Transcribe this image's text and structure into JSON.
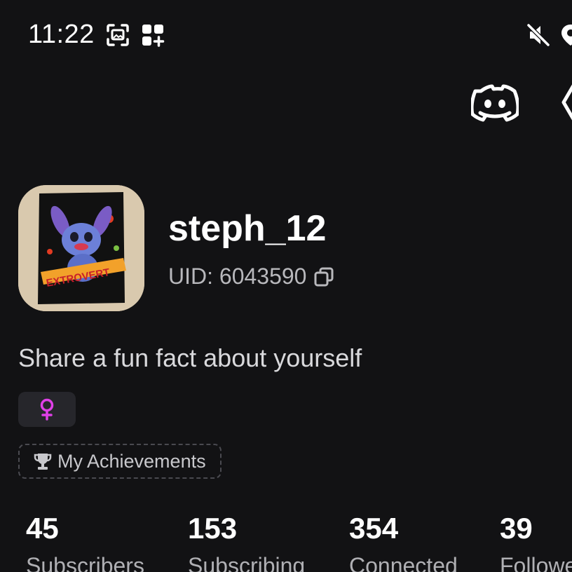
{
  "status_bar": {
    "time": "11:22",
    "icons": [
      "screenshot-icon",
      "apps-add-icon",
      "mute-icon",
      "location-icon"
    ]
  },
  "header_actions": {
    "icons": [
      "discord-icon",
      "share-icon"
    ]
  },
  "profile": {
    "avatar_text": "EXTROVERT",
    "username": "steph_12",
    "uid": "UID: 6043590",
    "bio": "Share a fun fact about yourself",
    "gender_icon": "female-icon",
    "achievements_label": "My Achievements",
    "achievements_icon": "trophy-icon"
  },
  "stats": [
    {
      "value": "45",
      "label": "Subscribers"
    },
    {
      "value": "153",
      "label": "Subscribing"
    },
    {
      "value": "354",
      "label": "Connected"
    },
    {
      "value": "39",
      "label": "Followers"
    }
  ],
  "colors": {
    "background": "#121214",
    "text_primary": "#ffffff",
    "text_secondary": "#b8b8bc",
    "chip_background": "#26262b",
    "female_accent": "#e040e8"
  }
}
